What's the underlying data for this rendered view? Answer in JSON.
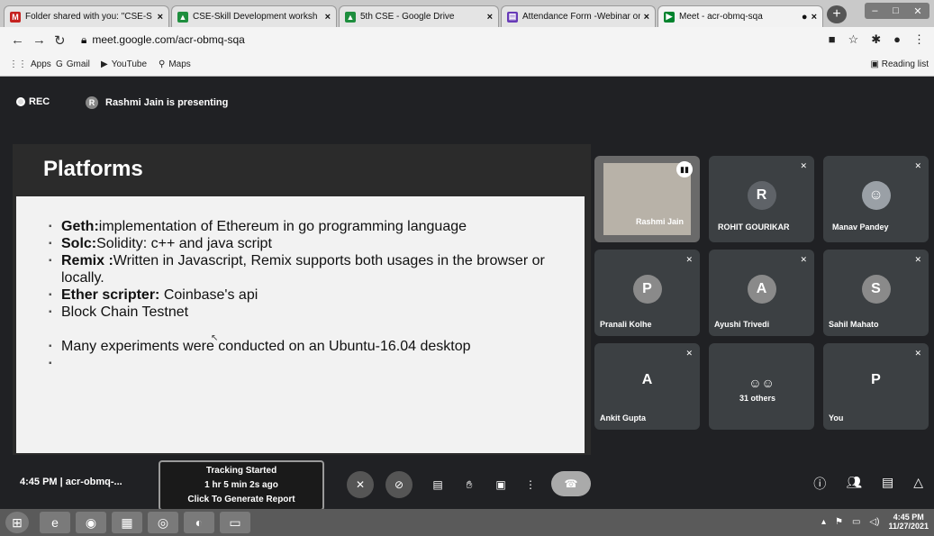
{
  "browser": {
    "tabs": [
      {
        "title": "Folder shared with you: \"CSE-S",
        "icon": "gmail-icon"
      },
      {
        "title": "CSE-Skill Development worksh",
        "icon": "drive-icon"
      },
      {
        "title": "5th CSE - Google Drive",
        "icon": "drive-icon"
      },
      {
        "title": "Attendance Form -Webinar on",
        "icon": "forms-icon"
      },
      {
        "title": "Meet - acr-obmq-sqa",
        "icon": "meet-icon"
      }
    ],
    "url": "meet.google.com/acr-obmq-sqa",
    "bookmarks": [
      "Apps",
      "Gmail",
      "YouTube",
      "Maps"
    ],
    "reading_list": "Reading list"
  },
  "meet": {
    "rec_label": "REC",
    "presenting_initial": "R",
    "presenting_text": "Rashmi Jain is presenting",
    "slide": {
      "title": "Platforms",
      "bullets": [
        {
          "bold": "Geth:",
          "text": "implementation of Ethereum in go programming language"
        },
        {
          "bold": "Solc:",
          "text": "Solidity: c++ and java script"
        },
        {
          "bold": "Remix :",
          "text": "Written in Javascript, Remix supports both usages in the browser or locally."
        },
        {
          "bold": "Ether scripter:",
          "text": " Coinbase's api"
        },
        {
          "bold": "",
          "text": "Block Chain Testnet"
        },
        {
          "bold": "",
          "text": ""
        },
        {
          "bold": "",
          "text": "Many experiments were conducted on an Ubuntu-16.04 desktop"
        }
      ]
    },
    "participants": [
      {
        "name": "Rashmi Jain",
        "initial": "",
        "type": "speaker"
      },
      {
        "name": "ROHIT GOURIKAR",
        "initial": "R",
        "type": "letter"
      },
      {
        "name": "Manav Pandey",
        "initial": "",
        "type": "photo"
      },
      {
        "name": "Pranali Kolhe",
        "initial": "P",
        "type": "avatar"
      },
      {
        "name": "Ayushi Trivedi",
        "initial": "A",
        "type": "avatar"
      },
      {
        "name": "Sahil Mahato",
        "initial": "S",
        "type": "avatar"
      },
      {
        "name": "Ankit Gupta",
        "initial": "A",
        "type": "letter"
      },
      {
        "name": "31 others",
        "initial": "",
        "type": "group"
      },
      {
        "name": "You",
        "initial": "P",
        "type": "letter"
      }
    ],
    "time": "4:45 PM",
    "meeting_code": "acr-obmq-...",
    "tracker": {
      "line1": "Tracking Started",
      "line2": "1 hr 5 min 2s ago",
      "line3": "Click To Generate Report"
    }
  },
  "taskbar": {
    "time": "4:45 PM",
    "date": "11/27/2021"
  }
}
